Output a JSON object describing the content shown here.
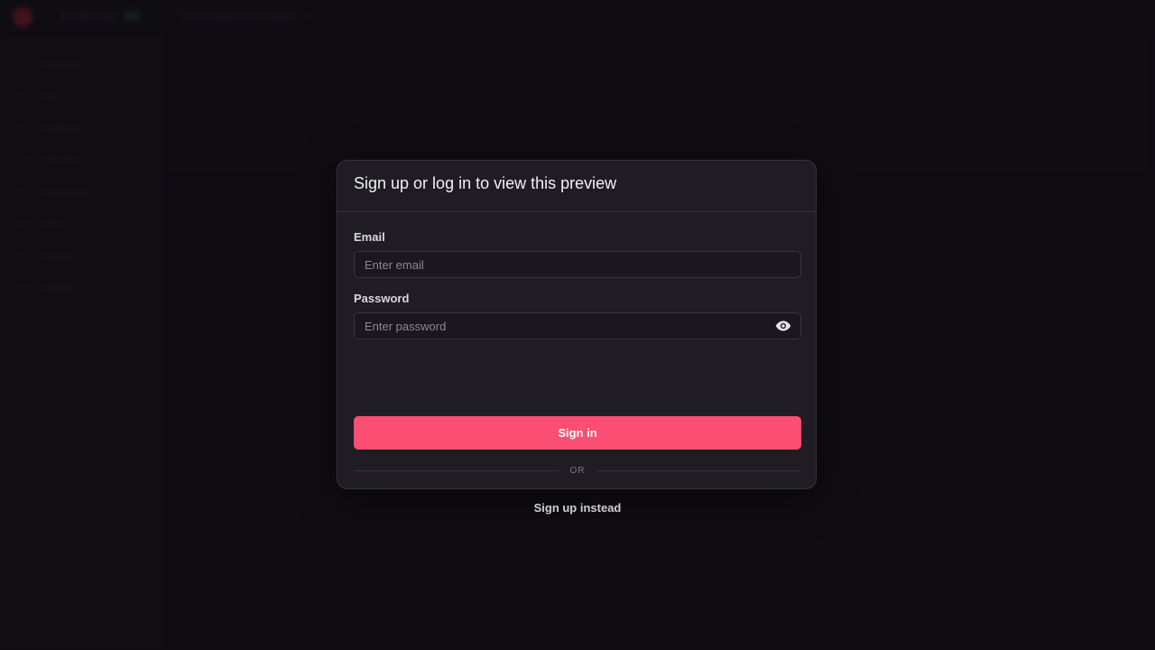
{
  "background": {
    "org_name": "Kevile's Org",
    "project_name": "Point Segmented Project",
    "sidebar_items": [
      {
        "label": "Overview",
        "icon": "home-icon"
      },
      {
        "label": "SQL",
        "icon": "code-icon"
      },
      {
        "label": "Database",
        "icon": "database-icon"
      },
      {
        "label": "Visualize",
        "icon": "chart-icon"
      },
      {
        "label": "Messaging",
        "icon": "message-icon"
      },
      {
        "label": "Docs",
        "icon": "book-icon"
      },
      {
        "label": "Storage",
        "icon": "storage-icon"
      },
      {
        "label": "Settings",
        "icon": "gear-icon"
      }
    ]
  },
  "modal": {
    "title": "Sign up or log in to view this preview",
    "email": {
      "label": "Email",
      "placeholder": "Enter email",
      "value": ""
    },
    "password": {
      "label": "Password",
      "placeholder": "Enter password",
      "value": "",
      "toggle_icon": "eye-icon"
    },
    "signin_label": "Sign in",
    "divider_text": "OR",
    "signup_label": "Sign up instead"
  },
  "colors": {
    "accent": "#fa4e72",
    "modal_bg": "#1f1d23",
    "page_bg": "#131117"
  }
}
